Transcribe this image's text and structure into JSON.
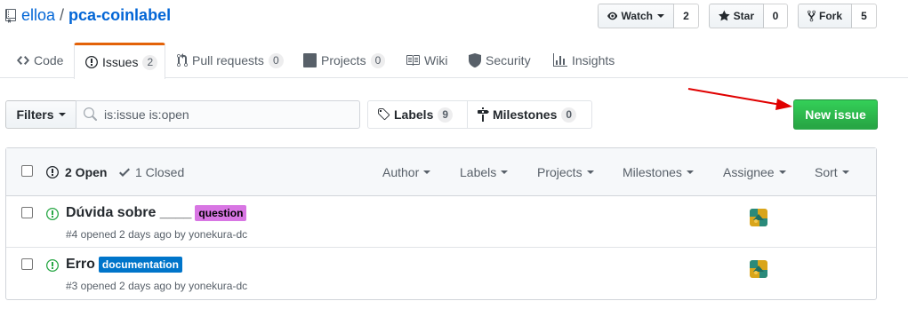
{
  "repo": {
    "owner": "elloa",
    "separator": "/",
    "name": "pca-coinlabel"
  },
  "actions": {
    "watch": {
      "label": "Watch",
      "count": "2"
    },
    "star": {
      "label": "Star",
      "count": "0"
    },
    "fork": {
      "label": "Fork",
      "count": "5"
    }
  },
  "reponav": {
    "code": {
      "label": "Code"
    },
    "issues": {
      "label": "Issues",
      "count": "2"
    },
    "pulls": {
      "label": "Pull requests",
      "count": "0"
    },
    "projects": {
      "label": "Projects",
      "count": "0"
    },
    "wiki": {
      "label": "Wiki"
    },
    "security": {
      "label": "Security"
    },
    "insights": {
      "label": "Insights"
    }
  },
  "subnav": {
    "filters_label": "Filters",
    "search_value": "is:issue is:open",
    "labels": {
      "label": "Labels",
      "count": "9"
    },
    "milestones": {
      "label": "Milestones",
      "count": "0"
    },
    "new_issue_label": "New issue"
  },
  "issues_header": {
    "open_label": "2 Open",
    "closed_label": "1 Closed",
    "filters": {
      "author": "Author",
      "labels": "Labels",
      "projects": "Projects",
      "milestones": "Milestones",
      "assignee": "Assignee",
      "sort": "Sort"
    }
  },
  "issues": [
    {
      "title": "Dúvida sobre ____",
      "label": {
        "name": "question",
        "color": "#d876e3",
        "text_color": "#000000"
      },
      "meta": "#4 opened 2 days ago by yonekura-dc"
    },
    {
      "title": "Erro",
      "label": {
        "name": "documentation",
        "color": "#0075ca",
        "text_color": "#ffffff"
      },
      "meta": "#3 opened 2 days ago by yonekura-dc"
    }
  ],
  "colors": {
    "link": "#0366d6",
    "open_green": "#28a745",
    "nav_accent": "#e36209",
    "annotation_arrow": "#e00000"
  }
}
